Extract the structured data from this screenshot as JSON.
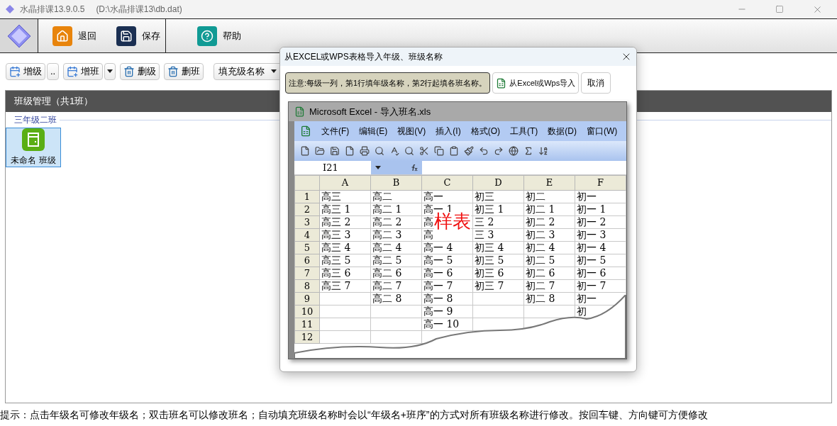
{
  "window": {
    "title": "水晶排课13.9.0.5",
    "path": "(D:\\水晶排课13\\db.dat)"
  },
  "ribbon": [
    {
      "kind": "home",
      "label": "退回"
    },
    {
      "kind": "save",
      "label": "保存"
    },
    {
      "kind": "help",
      "label": "帮助"
    }
  ],
  "toolbar": [
    {
      "kind": "add",
      "label": "增级"
    },
    {
      "kind": "text",
      "label": ".."
    },
    {
      "kind": "add",
      "label": "增班"
    },
    {
      "kind": "caret"
    },
    {
      "kind": "delete",
      "label": "删级"
    },
    {
      "kind": "delete",
      "label": "删班"
    },
    {
      "kind": "dropdown",
      "label": "填充级名称"
    }
  ],
  "panel": {
    "title": "班级管理（共1班）",
    "groups": [
      {
        "name": "三年级二班",
        "classes": [
          {
            "name": "未命名 班级",
            "selected": true
          }
        ]
      }
    ]
  },
  "status_bar": "提示：点击年级名可修改年级名；双击班名可以修改班名；自动填充班级名称时会以“年级名+班序”的方式对所有班级名称进行修改。按回车键、方向键可方便修改",
  "dialog": {
    "title": "从EXCEL或WPS表格导入年级、班级名称",
    "notice": "注意:每级一列，第1行填年级名称，第2行起填各班名称。",
    "import_button": "从Excel或Wps导入",
    "cancel_button": "取消",
    "sample": {
      "title": "Microsoft Excel - 导入班名.xls",
      "menu": [
        "文件(F)",
        "编辑(E)",
        "视图(V)",
        "插入(I)",
        "格式(O)",
        "工具(T)",
        "数据(D)",
        "窗口(W)"
      ],
      "name_box": "I21",
      "stamp": "样表",
      "columns": [
        "A",
        "B",
        "C",
        "D",
        "E",
        "F"
      ],
      "rows": [
        {
          "number": "1",
          "cells": [
            "高三",
            "高二",
            "高一",
            "初三",
            "初二",
            "初一"
          ]
        },
        {
          "number": "2",
          "cells": [
            "高三 1",
            "高二 1",
            "高一 1",
            "初三 1",
            "初二 1",
            "初一 1"
          ]
        },
        {
          "number": "3",
          "cells": [
            "高三 2",
            "高二 2",
            "高",
            "三 2",
            "初二 2",
            "初一 2"
          ]
        },
        {
          "number": "4",
          "cells": [
            "高三 3",
            "高二 3",
            "高",
            "三 3",
            "初二 3",
            "初一 3"
          ]
        },
        {
          "number": "5",
          "cells": [
            "高三 4",
            "高二 4",
            "高一 4",
            "初三 4",
            "初二 4",
            "初一 4"
          ]
        },
        {
          "number": "6",
          "cells": [
            "高三 5",
            "高二 5",
            "高一 5",
            "初三 5",
            "初二 5",
            "初一 5"
          ]
        },
        {
          "number": "7",
          "cells": [
            "高三 6",
            "高二 6",
            "高一 6",
            "初三 6",
            "初二 6",
            "初一 6"
          ]
        },
        {
          "number": "8",
          "cells": [
            "高三 7",
            "高二 7",
            "高一 7",
            "初三 7",
            "初二 7",
            "初一 7"
          ]
        },
        {
          "number": "9",
          "cells": [
            null,
            "高二 8",
            "高一 8",
            null,
            "初二 8",
            "初一"
          ]
        },
        {
          "number": "10",
          "cells": [
            null,
            null,
            "高一 9",
            null,
            null,
            "初"
          ]
        },
        {
          "number": "11",
          "cells": [
            null,
            null,
            "高一 10",
            null,
            null,
            null
          ]
        },
        {
          "number": "12",
          "cells": [
            null,
            null,
            null,
            null,
            null,
            null
          ]
        }
      ]
    }
  }
}
